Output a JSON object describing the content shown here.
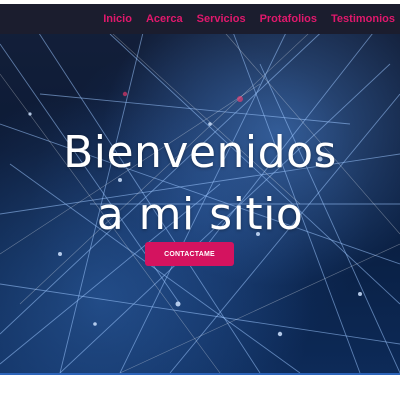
{
  "nav": {
    "items": [
      {
        "label": "Inicio"
      },
      {
        "label": "Acerca"
      },
      {
        "label": "Servicios"
      },
      {
        "label": "Protafolios"
      },
      {
        "label": "Testimonios"
      }
    ]
  },
  "hero": {
    "title_line_1": "Bienvenidos",
    "title_line_2": "a mi sitio",
    "cta_label": "CONTACTAME",
    "background": "network-connections-image"
  },
  "colors": {
    "accent": "#e0186c",
    "button": "#d4135f",
    "navbar_bg": "#1b1d2e",
    "hero_text": "#ffffff"
  }
}
